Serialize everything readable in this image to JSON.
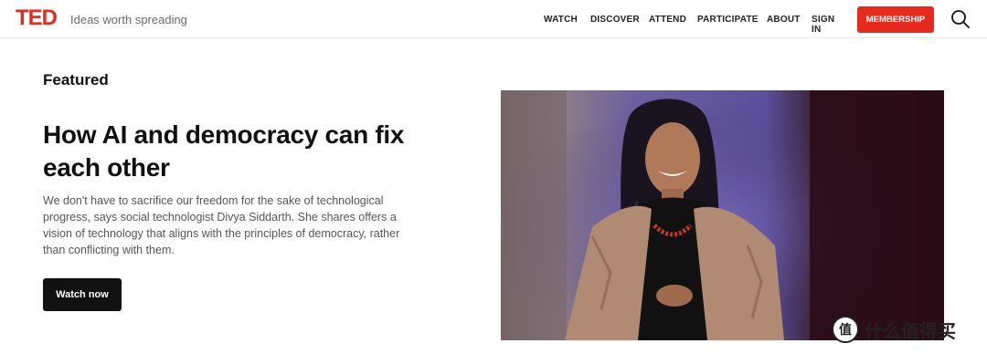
{
  "header": {
    "logo": "TED",
    "tagline": "Ideas worth spreading",
    "nav": [
      "WATCH",
      "DISCOVER",
      "ATTEND",
      "PARTICIPATE",
      "ABOUT",
      "SIGN IN"
    ],
    "membership_label": "MEMBERSHIP",
    "search_icon": "search-icon"
  },
  "main": {
    "section_label": "Featured",
    "title": "How AI and democracy can fix each other",
    "description": "We don't have to sacrifice our freedom for the sake of technological progress, says social technologist Divya Siddarth. She shares offers a vision of technology that aligns with the principles of democracy, rather than conflicting with them.",
    "cta_label": "Watch now"
  },
  "watermark": {
    "badge": "值",
    "text": "什么值得买"
  },
  "colors": {
    "brand_red": "#e62b1e",
    "text_dark": "#111111",
    "text_muted": "#555555"
  }
}
